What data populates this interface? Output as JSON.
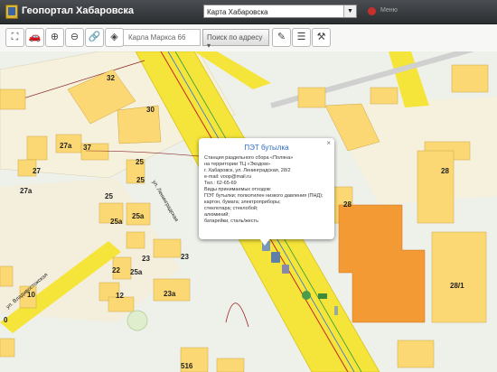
{
  "header": {
    "brand": "Геопортал Хабаровска",
    "map_select": "Карта Хабаровска",
    "menu": "Меню"
  },
  "toolbar": {
    "search_value": "Карла Маркса 66",
    "search_mode": "Поиск по адресу"
  },
  "map": {
    "labels": [
      "32",
      "30",
      "37",
      "25",
      "25",
      "25",
      "25a",
      "25a",
      "25a",
      "23",
      "23",
      "22",
      "23a",
      "12",
      "10",
      "0",
      "27",
      "27a",
      "27a",
      "28",
      "28",
      "28/1",
      "516"
    ],
    "streets": [
      "ул. Ленинградская",
      "ул. Владивостокская"
    ]
  },
  "popup": {
    "title": "ПЭТ бутылка",
    "lines": [
      "Станция раздельного сбора «Поляна»",
      "на территории ТЦ «Экодом»",
      "г. Хабаровск, ул. Ленинградская, 28/2",
      "e-mail: voop@mail.ru",
      "Тел.: 62-65-69",
      "Виды принимаемых отходов:",
      "ПЭТ бутылки; полиэтилен низкого давления (ПНД);",
      "картон, бумага; электроприборы;",
      "стеклотара; стеклобой;",
      "алюминий;",
      "батарейки, сталь/жесть"
    ],
    "close": "×"
  },
  "colors": {
    "road": "#f5e43a",
    "building": "#fbd873",
    "orange": "#f39a35"
  }
}
